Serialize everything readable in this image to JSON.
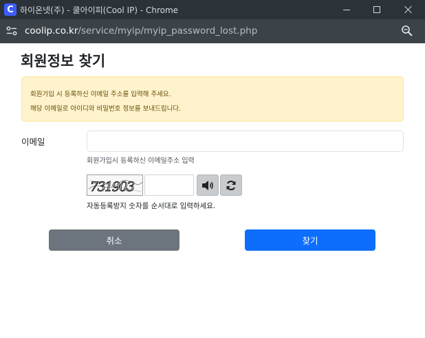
{
  "window": {
    "app_icon_letter": "C",
    "title": "하이온넷(주) - 쿨아이피(Cool IP) - Chrome"
  },
  "address_bar": {
    "url_host": "coolip.co.kr",
    "url_path": "/service/myip/myip_password_lost.php"
  },
  "page": {
    "title": "회원정보 찾기",
    "alert_lines": [
      "회원가입 시 등록하신 이메일 주소를 입력해 주세요.",
      "해당 이메일로 아이디와 비밀번호 정보를 보내드립니다."
    ],
    "email": {
      "label": "이메일",
      "value": "",
      "help": "회원가입시 등록하신 이메일주소 입력"
    },
    "captcha": {
      "image_text": "731903",
      "value": "",
      "help": "자동등록방지 숫자를 순서대로 입력하세요."
    },
    "buttons": {
      "cancel": "취소",
      "find": "찾기"
    }
  },
  "colors": {
    "title_bar": "#2b3238",
    "address_bar": "#3b4348",
    "alert_bg": "#fff3cd",
    "alert_text": "#664d03",
    "cancel_button": "#6c757d",
    "find_button": "#0d6efd"
  }
}
